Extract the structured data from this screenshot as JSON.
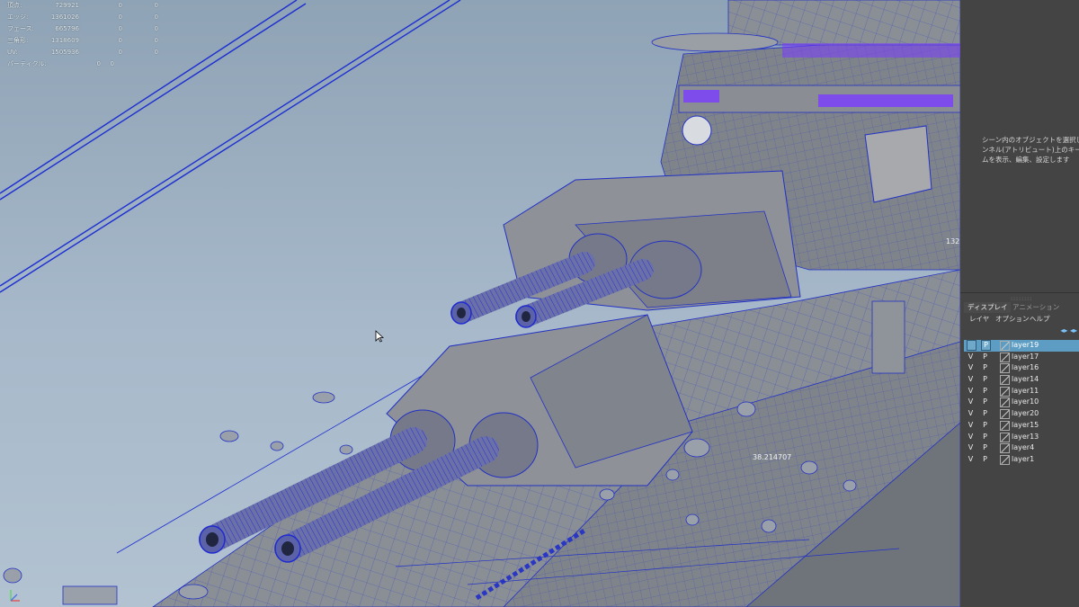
{
  "hud": {
    "rows": [
      {
        "label": "頂点:",
        "v1": "729921",
        "v2": "0",
        "v3": "0"
      },
      {
        "label": "エッジ:",
        "v1": "1361026",
        "v2": "0",
        "v3": "0"
      },
      {
        "label": "フェース:",
        "v1": "665796",
        "v2": "0",
        "v3": "0"
      },
      {
        "label": "三角形:",
        "v1": "1318609",
        "v2": "0",
        "v3": "0"
      },
      {
        "label": "UV:",
        "v1": "1505936",
        "v2": "0",
        "v3": "0"
      },
      {
        "label": "パーティクル:",
        "v1": "0",
        "v2": "0"
      }
    ]
  },
  "viewport": {
    "measure_value": "38.214707",
    "measure_value_2": "132",
    "wire_color": "#2133c8",
    "selection_color": "#7a2bff"
  },
  "panel": {
    "message": "シーン内のオブジェクトを選択し、チャンネル(アトリビュート)上のキーフレームを表示、編集、設定します",
    "tabs": {
      "display": "ディスプレイ",
      "animation": "アニメーション"
    },
    "menu": {
      "layers": "レイヤ",
      "options": "オプション",
      "help": "ヘルプ"
    },
    "layers": [
      {
        "v": "",
        "p": "P",
        "name": "layer19",
        "selected": true
      },
      {
        "v": "V",
        "p": "P",
        "name": "layer17"
      },
      {
        "v": "V",
        "p": "P",
        "name": "layer16"
      },
      {
        "v": "V",
        "p": "P",
        "name": "layer14"
      },
      {
        "v": "V",
        "p": "P",
        "name": "layer11"
      },
      {
        "v": "V",
        "p": "P",
        "name": "layer10"
      },
      {
        "v": "V",
        "p": "P",
        "name": "layer20"
      },
      {
        "v": "V",
        "p": "P",
        "name": "layer15"
      },
      {
        "v": "V",
        "p": "P",
        "name": "layer13"
      },
      {
        "v": "V",
        "p": "P",
        "name": "layer4"
      },
      {
        "v": "V",
        "p": "P",
        "name": "layer1"
      }
    ],
    "highlight_color": "#5d9dc3"
  }
}
